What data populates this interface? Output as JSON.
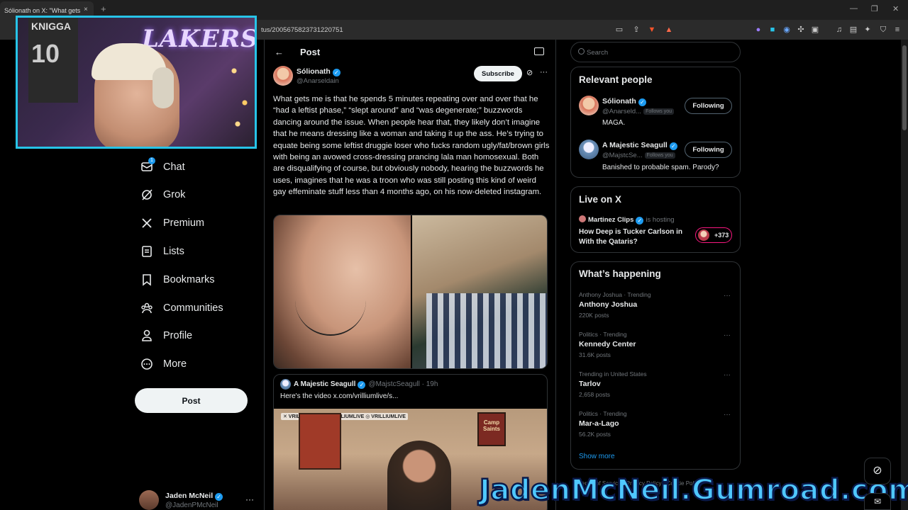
{
  "browser": {
    "tab_title": "Sólionath on X: \"What gets",
    "tab_close": "×",
    "new_tab": "+",
    "url": "tus/2005675823731220751"
  },
  "webcam": {
    "sign_text": "LAKERS",
    "jersey_name": "KNIGGA",
    "jersey_number": "10"
  },
  "nav": {
    "items": [
      {
        "label": "Chat",
        "icon": "chat-icon",
        "badge": "1"
      },
      {
        "label": "Grok",
        "icon": "grok-icon"
      },
      {
        "label": "Premium",
        "icon": "x-logo-icon"
      },
      {
        "label": "Lists",
        "icon": "lists-icon"
      },
      {
        "label": "Bookmarks",
        "icon": "bookmark-icon"
      },
      {
        "label": "Communities",
        "icon": "communities-icon"
      },
      {
        "label": "Profile",
        "icon": "profile-icon"
      },
      {
        "label": "More",
        "icon": "more-circle-icon"
      }
    ],
    "post_button": "Post",
    "account": {
      "name": "Jaden McNeil",
      "handle": "@JadenPMcNeil",
      "more": "···"
    }
  },
  "header": {
    "back": "←",
    "title": "Post"
  },
  "post": {
    "name": "Sólionath",
    "handle": "@Anarseldain",
    "subscribe": "Subscribe",
    "more": "···",
    "text": "What gets me is that he spends 5 minutes repeating over and over that he “had a leftist phase,” “slept around” and “was degenerate;” buzzwords dancing around the issue. When people hear that, they likely don’t imagine that he means dressing like a woman and taking it up the ass. He’s trying to equate being some leftist druggie loser who fucks random ugly/fat/brown girls with being an avowed cross-dressing prancing lala man homosexual. Both are disqualifying of course, but obviously nobody, hearing the buzzwords he uses, imagines that he was a troon who was still posting this kind of weird gay effeminate stuff less than 4 months ago, on his now-deleted instagram."
  },
  "quote": {
    "name": "A Majestic Seagull",
    "handle": "@MajstcSeagull · 19h",
    "text": "Here's the video  x.com/vrilliumlive/s...",
    "sign": "Camp Saints",
    "logos": "✕ VRILLIUMLIVE  ▶ VRILLIUMLIVE  ◎ VRILLIUMLIVE"
  },
  "search": {
    "placeholder": "Search"
  },
  "relevant_people": {
    "title": "Relevant people",
    "people": [
      {
        "name": "Sólionath",
        "handle": "@Anarseld...",
        "follows_you": "Follows you",
        "bio": "MAGA.",
        "button": "Following"
      },
      {
        "name": "A Majestic Seagull",
        "handle": "@MajstcSe...",
        "follows_you": "Follows you",
        "bio": "Banished to probable spam. Parody?",
        "button": "Following"
      }
    ]
  },
  "live": {
    "title": "Live on X",
    "host": "Martinez Clips",
    "hosting": "is hosting",
    "space_title": "How Deep is Tucker Carlson in With the Qataris?",
    "count": "+373"
  },
  "happening": {
    "title": "What’s happening",
    "trends": [
      {
        "meta": "Anthony Joshua · Trending",
        "name": "Anthony Joshua",
        "count": "220K posts"
      },
      {
        "meta": "Politics · Trending",
        "name": "Kennedy Center",
        "count": "31.6K posts"
      },
      {
        "meta": "Trending in United States",
        "name": "Tarlov",
        "count": "2,658 posts"
      },
      {
        "meta": "Politics · Trending",
        "name": "Mar-a-Lago",
        "count": "56.2K posts"
      }
    ],
    "show_more": "Show more"
  },
  "footer": {
    "links": "Terms of Service · Privacy Policy · Cookie Policy"
  },
  "watermark": "JadenMcNeil.Gumroad.com",
  "colors": {
    "accent": "#1d9bf0",
    "webcam_border": "#27c4e8",
    "live_pink": "#f91880",
    "watermark": "#4fc8ff"
  }
}
